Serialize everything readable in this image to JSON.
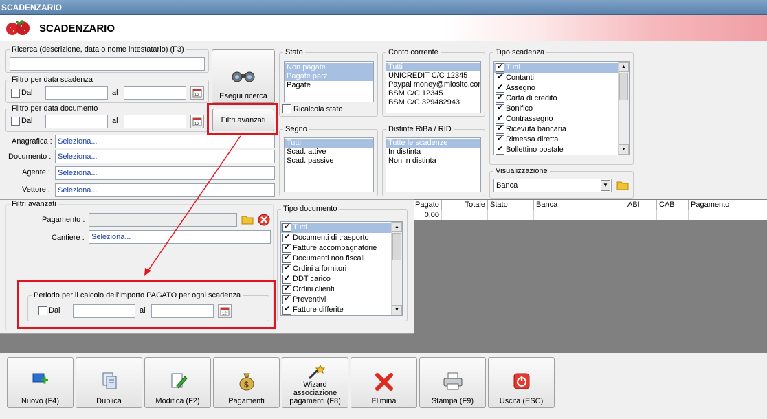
{
  "window": {
    "title": "SCADENZARIO"
  },
  "header": {
    "title": "SCADENZARIO"
  },
  "search": {
    "legend": "Ricerca (descrizione, data o nome intestatario) (F3)",
    "value": ""
  },
  "filter_due": {
    "legend": "Filtro per data scadenza",
    "from_label": "Dal",
    "to_label": "al"
  },
  "filter_doc": {
    "legend": "Filtro per data documento",
    "from_label": "Dal",
    "to_label": "al"
  },
  "buttons": {
    "search": "Esegui ricerca",
    "advanced": "Filtri avanzati"
  },
  "fields": [
    {
      "label": "Anagrafica :",
      "value": "Seleziona..."
    },
    {
      "label": "Documento :",
      "value": "Seleziona..."
    },
    {
      "label": "Agente :",
      "value": "Seleziona..."
    },
    {
      "label": "Vettore :",
      "value": "Seleziona..."
    }
  ],
  "stato": {
    "legend": "Stato",
    "items": [
      "Non pagate",
      "Pagate parz.",
      "Pagate"
    ],
    "recalc_label": "Ricalcola stato"
  },
  "conto": {
    "legend": "Conto corrente",
    "items": [
      "Tutti",
      "UNICREDIT C/C 12345",
      "Paypal money@miosito.com",
      "BSM C/C 12345",
      "BSM C/C 329482943"
    ]
  },
  "tipo_scadenza": {
    "legend": "Tipo scadenza",
    "items": [
      "Tutti",
      "Contanti",
      "Assegno",
      "Carta di credito",
      "Bonifico",
      "Contrassegno",
      "Ricevuta bancaria",
      "Rimessa diretta",
      "Bollettino postale"
    ]
  },
  "segno": {
    "legend": "Segno",
    "items": [
      "Tutti",
      "Scad. attive",
      "Scad. passive"
    ]
  },
  "distinte": {
    "legend": "Distinte RiBa / RID",
    "items": [
      "Tutte le scadenze",
      "In distinta",
      "Non in distinta"
    ]
  },
  "visualizzazione": {
    "legend": "Visualizzazione",
    "value": "Banca"
  },
  "advanced": {
    "legend": "Filtri avanzati",
    "pagamento_label": "Pagamento :",
    "pagamento_value": "",
    "cantiere_label": "Cantiere :",
    "cantiere_value": "Seleziona...",
    "period_legend": "Periodo per il calcolo dell'importo PAGATO per ogni scadenza",
    "period_from": "Dal",
    "period_to": "al"
  },
  "tipo_documento": {
    "legend": "Tipo documento",
    "items": [
      "Tutti",
      "Documenti di trasporto",
      "Fatture accompagnatorie",
      "Documenti non fiscali",
      "Ordini a fornitori",
      "DDT carico",
      "Ordini clienti",
      "Preventivi",
      "Fatture differite"
    ]
  },
  "grid": {
    "columns": [
      "Pagato",
      "Totale",
      "Stato",
      "Banca",
      "ABI",
      "CAB",
      "Pagamento"
    ],
    "row": {
      "pagato": "0,00"
    }
  },
  "toolbar": [
    {
      "label": "Nuovo (F4)",
      "icon": "new-icon"
    },
    {
      "label": "Duplica",
      "icon": "duplicate-icon"
    },
    {
      "label": "Modifica (F2)",
      "icon": "edit-icon"
    },
    {
      "label": "Pagamenti",
      "icon": "money-bag-icon"
    },
    {
      "label": "Wizard associazione pagamenti (F8)",
      "icon": "wizard-icon"
    },
    {
      "label": "Elimina",
      "icon": "delete-icon"
    },
    {
      "label": "Stampa (F9)",
      "icon": "printer-icon"
    },
    {
      "label": "Uscita (ESC)",
      "icon": "exit-icon"
    }
  ],
  "colors": {
    "highlight": "#e0141e",
    "selection": "#a7bfe0",
    "link": "#1a3ea8",
    "grid_bg": "#808080"
  }
}
